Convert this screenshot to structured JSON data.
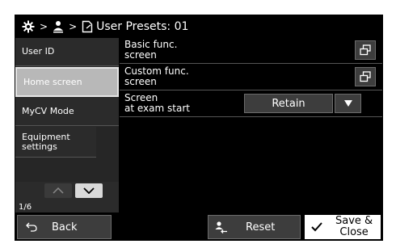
{
  "header": {
    "breadcrumb_title": "User Presets: 01"
  },
  "sidebar": {
    "items": [
      {
        "label": "User ID",
        "active": false
      },
      {
        "label": "Home screen",
        "active": true
      },
      {
        "label": "MyCV Mode",
        "active": false
      },
      {
        "label": "Equipment settings",
        "active": false
      }
    ],
    "page_indicator": "1/6"
  },
  "main": {
    "rows": [
      {
        "label_line1": "Basic func.",
        "label_line2": "screen",
        "control": "open-window"
      },
      {
        "label_line1": "Custom func.",
        "label_line2": "screen",
        "control": "open-window"
      },
      {
        "label_line1": "Screen",
        "label_line2": "at exam start",
        "control": "select",
        "value": "Retain"
      }
    ]
  },
  "footer": {
    "back_label": "Back",
    "reset_label": "Reset",
    "save_label_line1": "Save &",
    "save_label_line2": "Close"
  },
  "icons": [
    "gear-icon",
    "user-icon",
    "document-icon",
    "open-window-icon",
    "chevron-up-icon",
    "chevron-down-icon",
    "back-arrow-icon",
    "reset-user-icon",
    "checkmark-icon",
    "dropdown-arrow-icon"
  ],
  "colors": {
    "background": "#000000",
    "panel": "#2b2b2b",
    "button": "#3d3d3d",
    "active_item": "#b8b8b8",
    "save_button": "#ffffff"
  }
}
